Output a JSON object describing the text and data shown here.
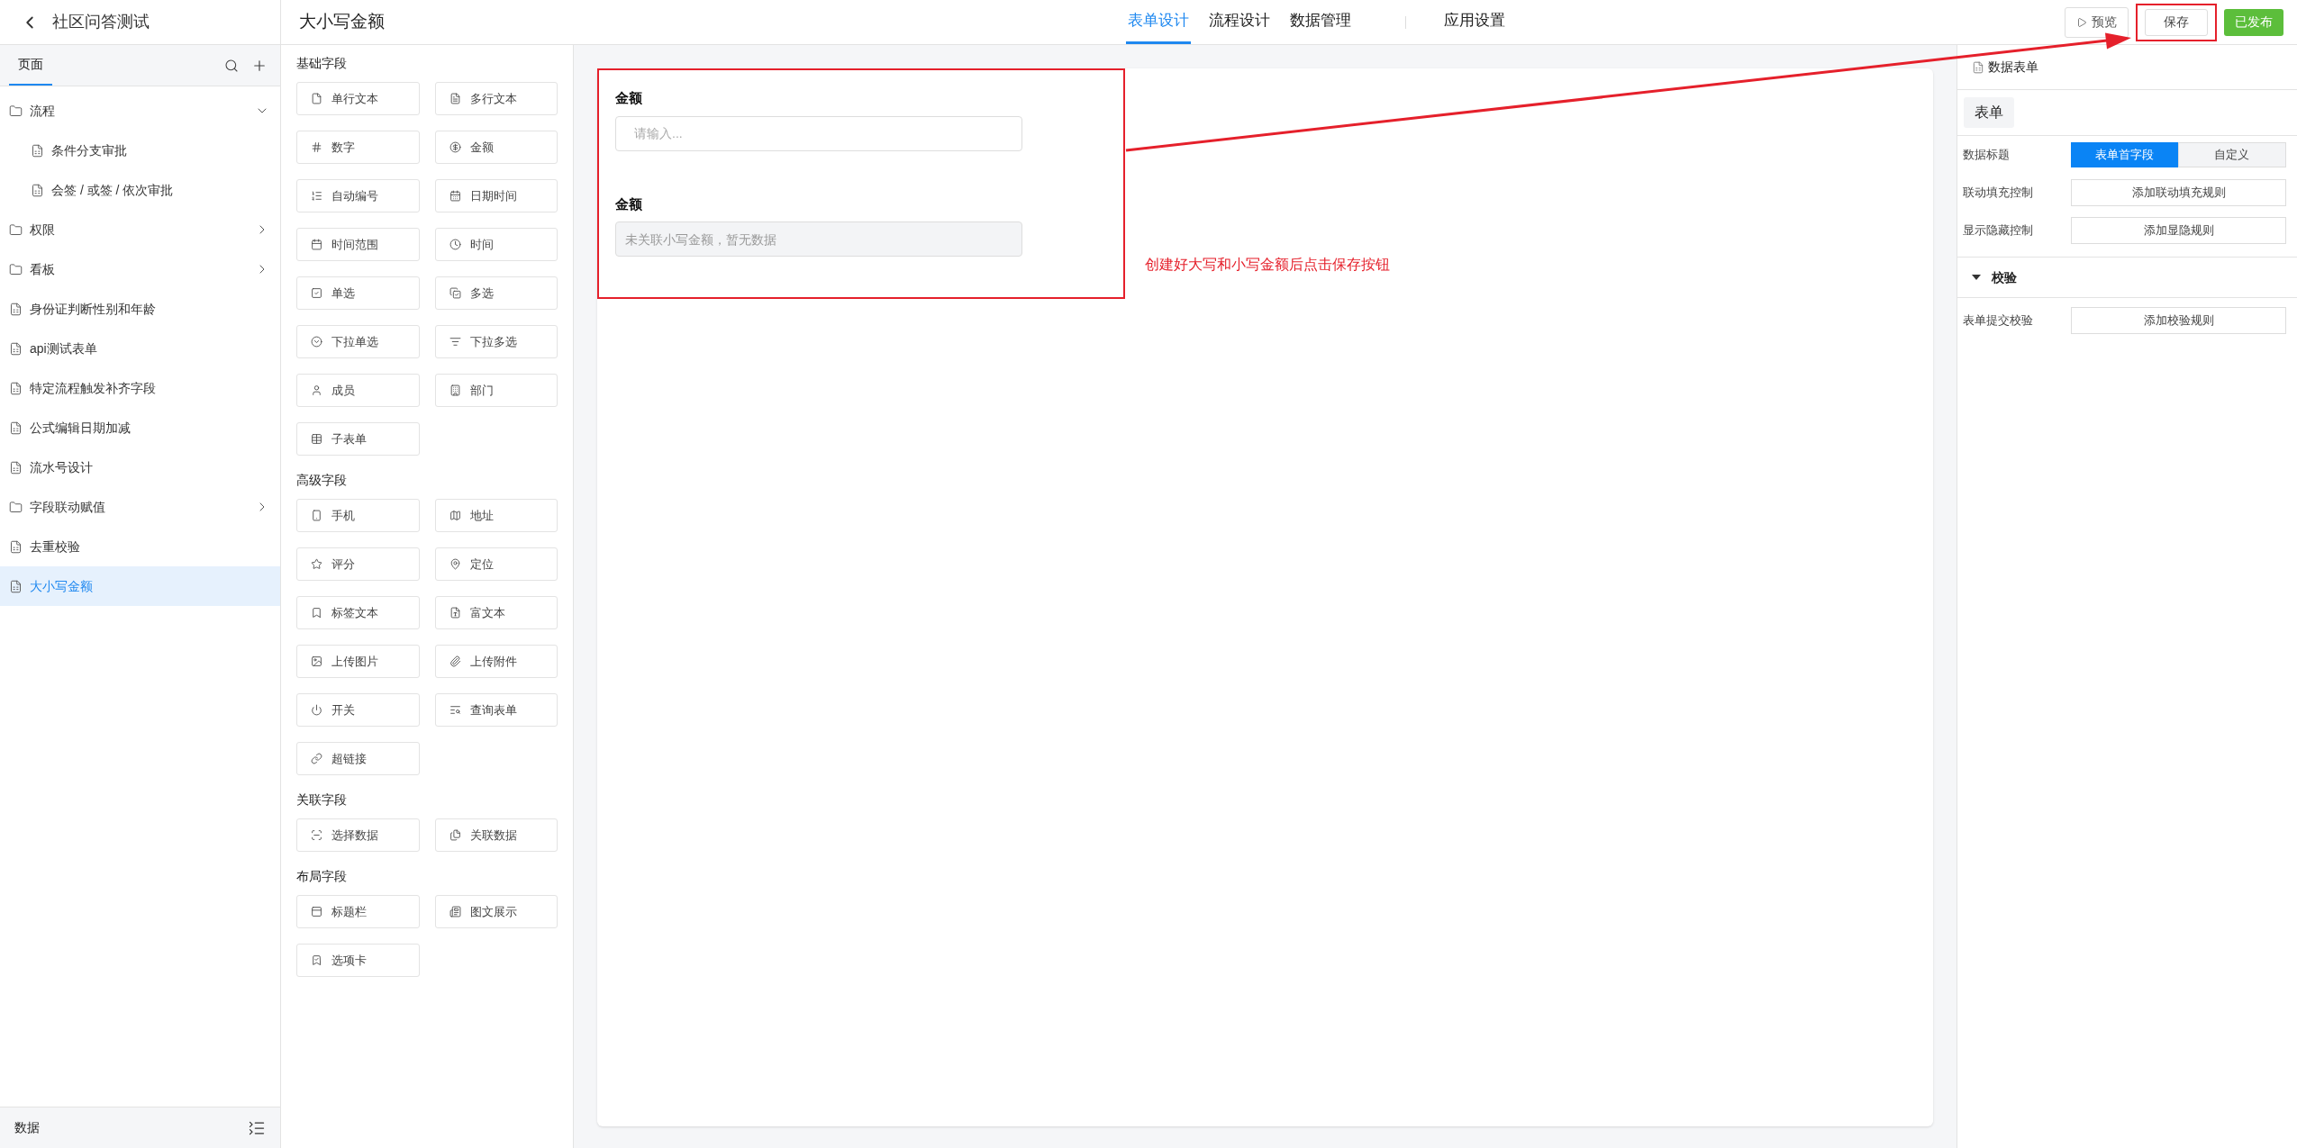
{
  "sidebar": {
    "title": "社区问答测试",
    "tabs": [
      {
        "label": "页面",
        "selected": true
      }
    ],
    "items": [
      {
        "kind": "folder",
        "label": "流程",
        "expanded": true,
        "selected": false,
        "children": [
          {
            "kind": "page",
            "label": "条件分支审批",
            "selected": false
          },
          {
            "kind": "page",
            "label": "会签 / 或签 / 依次审批",
            "selected": false
          }
        ]
      },
      {
        "kind": "folder",
        "label": "权限",
        "expanded": false,
        "selected": false
      },
      {
        "kind": "folder",
        "label": "看板",
        "expanded": false,
        "selected": false
      },
      {
        "kind": "page",
        "label": "身份证判断性别和年龄",
        "selected": false
      },
      {
        "kind": "page",
        "label": "api测试表单",
        "selected": false
      },
      {
        "kind": "page",
        "label": "特定流程触发补齐字段",
        "selected": false
      },
      {
        "kind": "page",
        "label": "公式编辑日期加减",
        "selected": false
      },
      {
        "kind": "page",
        "label": "流水号设计",
        "selected": false
      },
      {
        "kind": "folder",
        "label": "字段联动赋值",
        "expanded": false,
        "selected": false
      },
      {
        "kind": "page",
        "label": "去重校验",
        "selected": false
      },
      {
        "kind": "page",
        "label": "大小写金额",
        "selected": true
      }
    ],
    "footer": "数据"
  },
  "header": {
    "title": "大小写金额",
    "tabs": [
      {
        "label": "表单设计",
        "selected": true
      },
      {
        "label": "流程设计",
        "selected": false
      },
      {
        "label": "数据管理",
        "selected": false
      },
      {
        "label": "应用设置",
        "selected": false
      }
    ],
    "buttons": [
      {
        "kind": "preview",
        "label": "预览",
        "highlighted": false
      },
      {
        "kind": "save",
        "label": "保存",
        "highlighted": true
      },
      {
        "kind": "published",
        "label": "已发布",
        "highlighted": false
      }
    ]
  },
  "palette": {
    "sections": [
      {
        "title": "基础字段",
        "items": [
          "单行文本",
          "多行文本",
          "数字",
          "金额",
          "自动编号",
          "日期时间",
          "时间范围",
          "时间",
          "单选",
          "多选",
          "下拉单选",
          "下拉多选",
          "成员",
          "部门",
          "子表单"
        ]
      },
      {
        "title": "高级字段",
        "items": [
          "手机",
          "地址",
          "评分",
          "定位",
          "标签文本",
          "富文本",
          "上传图片",
          "上传附件",
          "开关",
          "查询表单",
          "超链接"
        ]
      },
      {
        "title": "关联字段",
        "items": [
          "选择数据",
          "关联数据"
        ]
      },
      {
        "title": "布局字段",
        "items": [
          "标题栏",
          "图文展示",
          "选项卡"
        ]
      }
    ]
  },
  "canvas": {
    "highlighted": true,
    "fields": [
      {
        "label": "金额",
        "placeholder": "请输入...",
        "disabled": false
      },
      {
        "label": "金额",
        "placeholder": "未关联小写金额，暂无数据",
        "disabled": true
      }
    ],
    "annotation": "创建好大写和小写金额后点击保存按钮"
  },
  "properties": {
    "title": "数据表单",
    "tab": "表单",
    "rows": [
      {
        "kind": "segmented",
        "label": "数据标题",
        "options": [
          {
            "label": "表单首字段",
            "selected": true
          },
          {
            "label": "自定义",
            "selected": false
          }
        ]
      },
      {
        "kind": "button",
        "label": "联动填充控制",
        "button": "添加联动填充规则"
      },
      {
        "kind": "button",
        "label": "显示隐藏控制",
        "button": "添加显隐规则"
      }
    ],
    "section": {
      "title": "校验",
      "expanded": true,
      "rows": [
        {
          "kind": "button",
          "label": "表单提交校验",
          "button": "添加校验规则"
        }
      ]
    }
  }
}
